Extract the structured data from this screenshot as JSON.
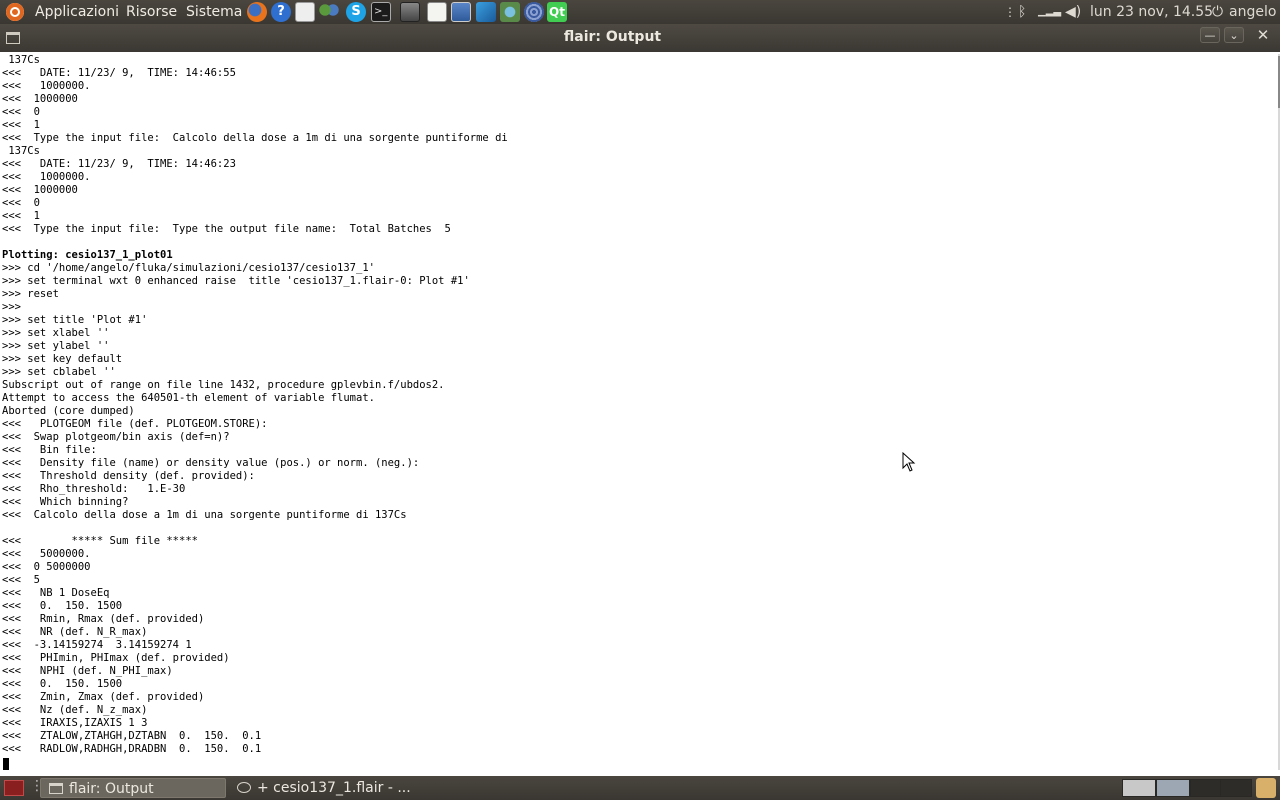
{
  "top_panel": {
    "menus": [
      "Applicazioni",
      "Risorse",
      "Sistema"
    ],
    "clock": "lun 23 nov, 14.55",
    "user": "angelo",
    "launchers": [
      "firefox-icon",
      "help-icon",
      "mail-icon",
      "pidgin-icon",
      "skype-icon",
      "terminal-icon",
      "flair-icon",
      "text-editor-icon",
      "system-monitor-icon",
      "app-icon",
      "paraview-icon",
      "gimp-icon",
      "qt-icon"
    ],
    "tray_icons": [
      "handle-icon",
      "bluetooth-icon",
      "network-icon",
      "volume-icon",
      "power-icon"
    ]
  },
  "window": {
    "title": "flair: Output"
  },
  "output_lines": [
    {
      "text": " 137Cs"
    },
    {
      "text": "<<<   DATE: 11/23/ 9,  TIME: 14:46:55"
    },
    {
      "text": "<<<   1000000."
    },
    {
      "text": "<<<  1000000"
    },
    {
      "text": "<<<  0"
    },
    {
      "text": "<<<  1"
    },
    {
      "text": "<<<  Type the input file:  Calcolo della dose a 1m di una sorgente puntiforme di"
    },
    {
      "text": " 137Cs"
    },
    {
      "text": "<<<   DATE: 11/23/ 9,  TIME: 14:46:23"
    },
    {
      "text": "<<<   1000000."
    },
    {
      "text": "<<<  1000000"
    },
    {
      "text": "<<<  0"
    },
    {
      "text": "<<<  1"
    },
    {
      "text": "<<<  Type the input file:  Type the output file name:  Total Batches  5"
    },
    {
      "text": ""
    },
    {
      "text": "Plotting: cesio137_1_plot01",
      "bold": true
    },
    {
      "text": ">>> cd '/home/angelo/fluka/simulazioni/cesio137/cesio137_1'"
    },
    {
      "text": ">>> set terminal wxt 0 enhanced raise  title 'cesio137_1.flair-0: Plot #1'"
    },
    {
      "text": ">>> reset"
    },
    {
      "text": ">>>"
    },
    {
      "text": ">>> set title 'Plot #1'"
    },
    {
      "text": ">>> set xlabel ''"
    },
    {
      "text": ">>> set ylabel ''"
    },
    {
      "text": ">>> set key default"
    },
    {
      "text": ">>> set cblabel ''"
    },
    {
      "text": "Subscript out of range on file line 1432, procedure gplevbin.f/ubdos2."
    },
    {
      "text": "Attempt to access the 640501-th element of variable flumat."
    },
    {
      "text": "Aborted (core dumped)"
    },
    {
      "text": "<<<   PLOTGEOM file (def. PLOTGEOM.STORE):"
    },
    {
      "text": "<<<  Swap plotgeom/bin axis (def=n)?"
    },
    {
      "text": "<<<   Bin file:"
    },
    {
      "text": "<<<   Density file (name) or density value (pos.) or norm. (neg.):"
    },
    {
      "text": "<<<   Threshold density (def. provided):"
    },
    {
      "text": "<<<   Rho_threshold:   1.E-30"
    },
    {
      "text": "<<<   Which binning?"
    },
    {
      "text": "<<<  Calcolo della dose a 1m di una sorgente puntiforme di 137Cs"
    },
    {
      "text": ""
    },
    {
      "text": "<<<        ***** Sum file *****"
    },
    {
      "text": "<<<   5000000."
    },
    {
      "text": "<<<  0 5000000"
    },
    {
      "text": "<<<  5"
    },
    {
      "text": "<<<   NB 1 DoseEq"
    },
    {
      "text": "<<<   0.  150. 1500"
    },
    {
      "text": "<<<   Rmin, Rmax (def. provided)"
    },
    {
      "text": "<<<   NR (def. N_R_max)"
    },
    {
      "text": "<<<  -3.14159274  3.14159274 1"
    },
    {
      "text": "<<<   PHImin, PHImax (def. provided)"
    },
    {
      "text": "<<<   NPHI (def. N_PHI_max)"
    },
    {
      "text": "<<<   0.  150. 1500"
    },
    {
      "text": "<<<   Zmin, Zmax (def. provided)"
    },
    {
      "text": "<<<   Nz (def. N_z_max)"
    },
    {
      "text": "<<<   IRAXIS,IZAXIS 1 3"
    },
    {
      "text": "<<<   ZTALOW,ZTAHGH,DZTABN  0.  150.  0.1"
    },
    {
      "text": "<<<   RADLOW,RADHGH,DRADBN  0.  150.  0.1"
    }
  ],
  "taskbar": {
    "tasks": [
      {
        "label": "flair: Output",
        "active": true
      },
      {
        "label": "+ cesio137_1.flair - ...",
        "active": false
      }
    ]
  }
}
